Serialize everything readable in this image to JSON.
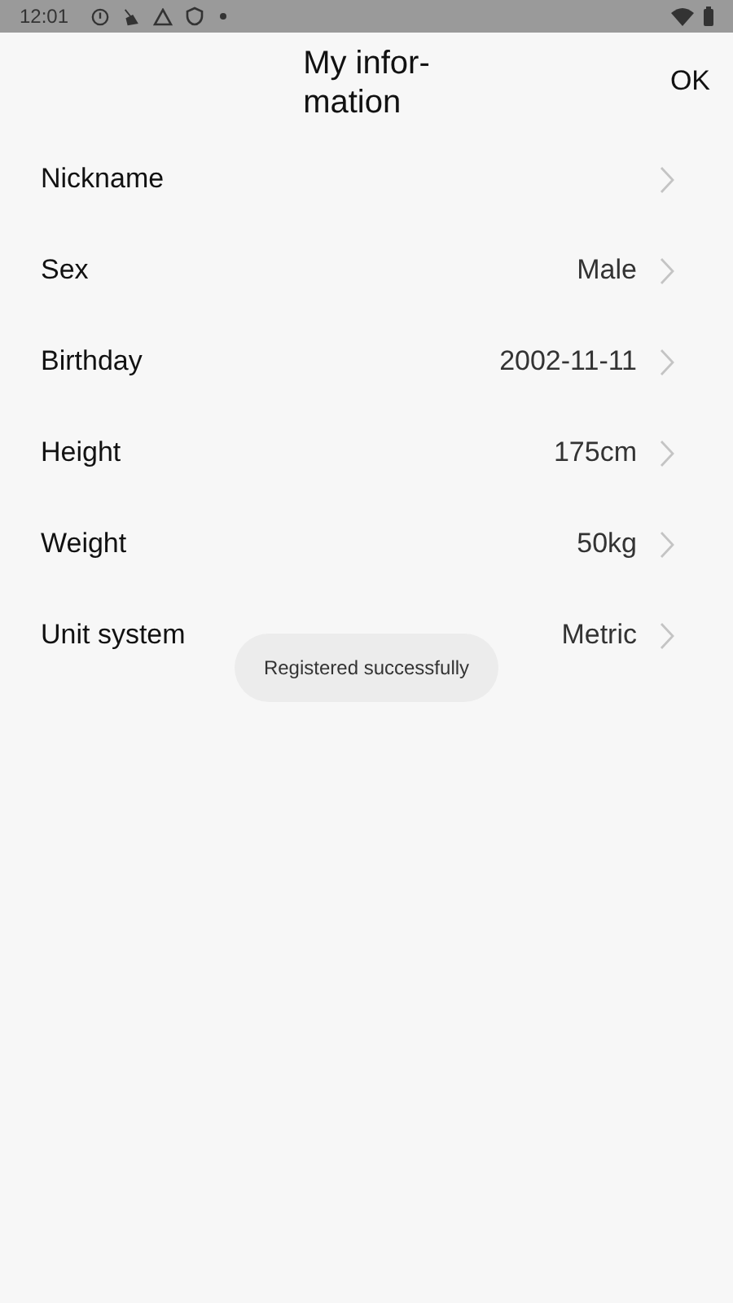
{
  "status_bar": {
    "time": "12:01"
  },
  "header": {
    "title": "My infor-\nmation",
    "action": "OK"
  },
  "rows": [
    {
      "label": "Nickname"
    },
    {
      "label": "Sex",
      "value": "Male"
    },
    {
      "label": "Birthday",
      "value": "2002-11-11"
    },
    {
      "label": "Height",
      "value": "175cm"
    },
    {
      "label": "Weight",
      "value": "50kg"
    },
    {
      "label": "Unit system",
      "value": "Metric"
    }
  ],
  "toast": {
    "message": "Registered successfully"
  }
}
